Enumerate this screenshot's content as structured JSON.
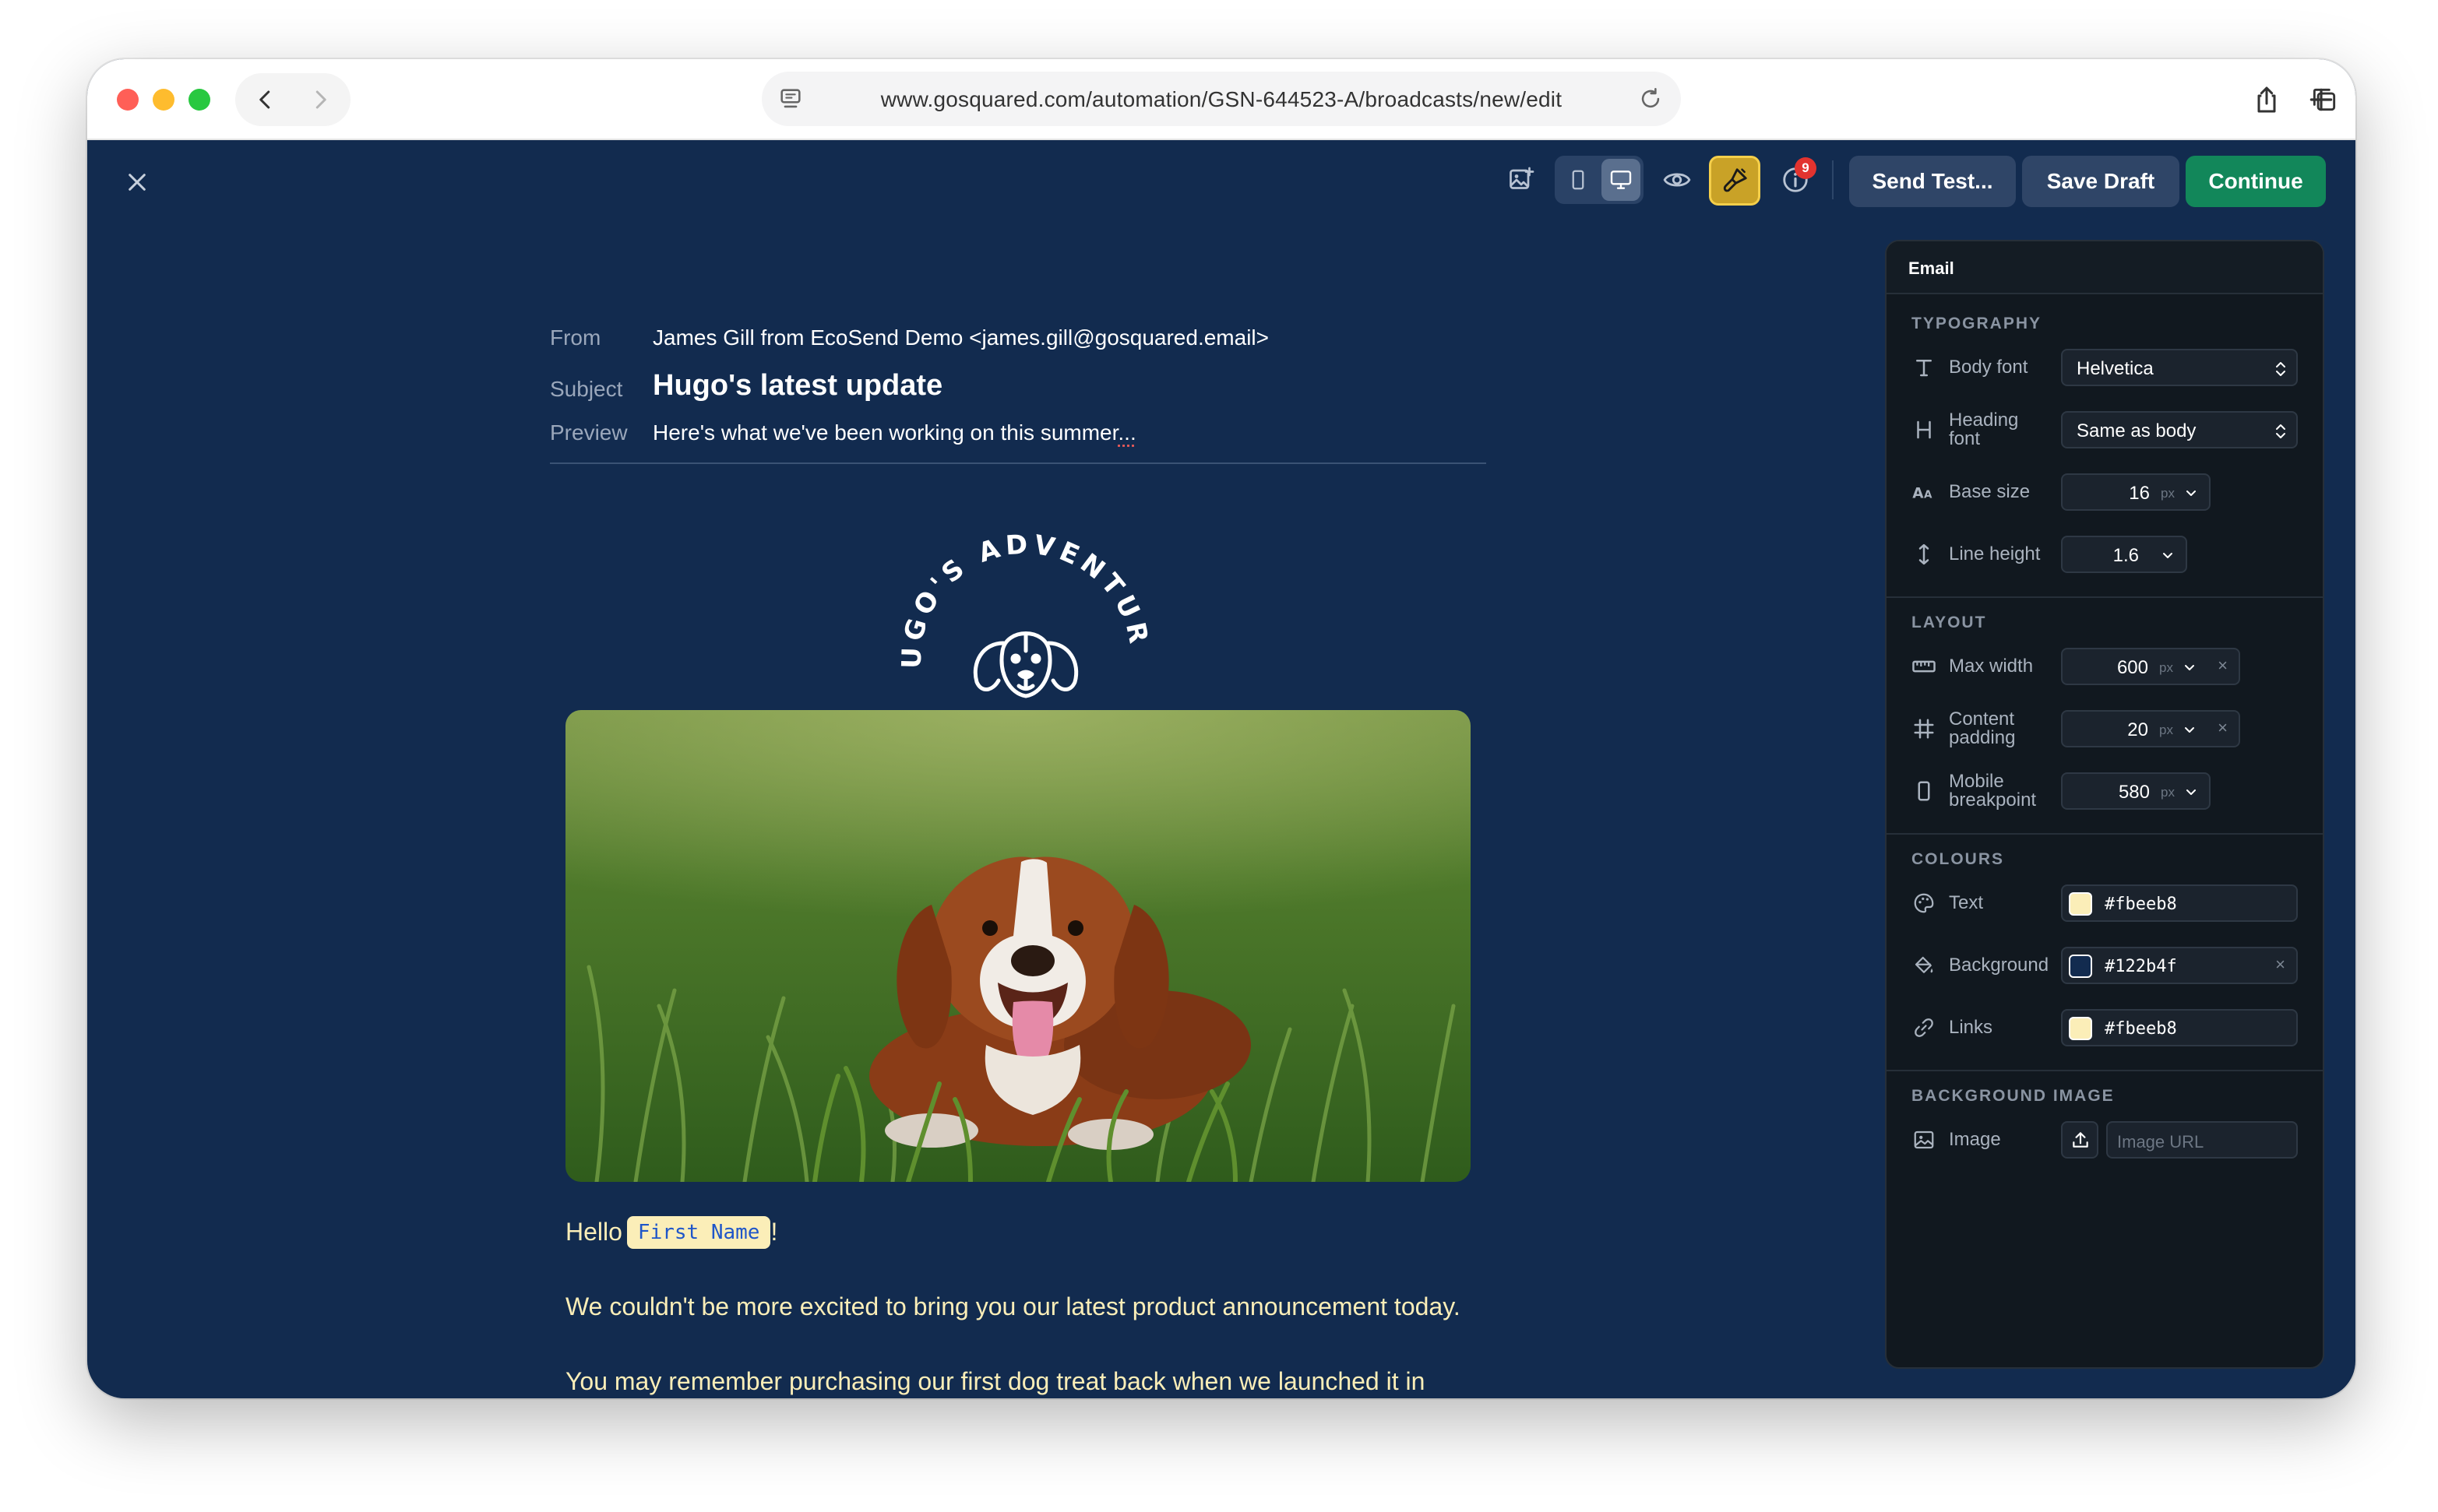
{
  "browser": {
    "url": "www.gosquared.com/automation/GSN-644523-A/broadcasts/new/edit"
  },
  "toolbar": {
    "notification_count": "9",
    "send_test_label": "Send Test...",
    "save_draft_label": "Save Draft",
    "continue_label": "Continue"
  },
  "email": {
    "from_label": "From",
    "from_value": "James Gill from EcoSend Demo <james.gill@gosquared.email>",
    "subject_label": "Subject",
    "subject_value": "Hugo's latest update",
    "preview_label": "Preview",
    "preview_value": "Here's what we've been working on this summer",
    "preview_ellipsis": "...",
    "logo_text": "HUGO'S ADVENTURES",
    "greeting": "Hello",
    "merge_tag": "First Name",
    "greeting_end": "!",
    "paragraph_1": "We couldn't be more excited to bring you our latest product announcement today.",
    "paragraph_2": "You may remember purchasing our first dog treat back when we launched it in"
  },
  "panel": {
    "title": "Email",
    "typography": {
      "title": "TYPOGRAPHY",
      "body_font_label": "Body font",
      "body_font_value": "Helvetica",
      "heading_font_label_1": "Heading",
      "heading_font_label_2": "font",
      "heading_font_value": "Same as body",
      "base_size_label": "Base size",
      "base_size_value": "16",
      "base_size_unit": "px",
      "line_height_label": "Line height",
      "line_height_value": "1.6"
    },
    "layout": {
      "title": "LAYOUT",
      "max_width_label": "Max width",
      "max_width_value": "600",
      "max_width_unit": "px",
      "content_padding_label_1": "Content",
      "content_padding_label_2": "padding",
      "content_padding_value": "20",
      "content_padding_unit": "px",
      "mobile_breakpoint_label_1": "Mobile",
      "mobile_breakpoint_label_2": "breakpoint",
      "mobile_breakpoint_value": "580",
      "mobile_breakpoint_unit": "px"
    },
    "colours": {
      "title": "COLOURS",
      "text_label": "Text",
      "text_value": "#fbeeb8",
      "background_label": "Background",
      "background_value": "#122b4f",
      "links_label": "Links",
      "links_value": "#fbeeb8"
    },
    "background_image": {
      "title": "BACKGROUND IMAGE",
      "image_label": "Image",
      "image_placeholder": "Image URL"
    }
  },
  "colors": {
    "app_background": "#122b4f",
    "email_text": "#fbeeb8",
    "continue_green": "#12875a",
    "brush_active": "#c9a227"
  }
}
